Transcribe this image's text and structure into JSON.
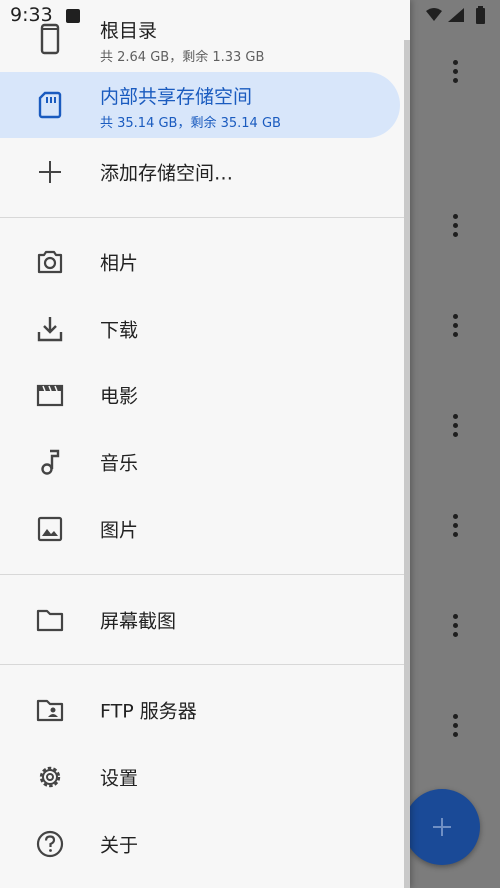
{
  "status_bar": {
    "time": "9:33"
  },
  "storage": [
    {
      "title": "根目录",
      "sub": "共 2.64 GB，剩余 1.33 GB",
      "icon": "phone-icon",
      "active": false
    },
    {
      "title": "内部共享存储空间",
      "sub": "共 35.14 GB，剩余 35.14 GB",
      "icon": "sd-card-icon",
      "active": true
    }
  ],
  "add_storage": {
    "label": "添加存储空间…",
    "icon": "plus-icon"
  },
  "libraries": [
    {
      "label": "相片",
      "icon": "camera-icon"
    },
    {
      "label": "下载",
      "icon": "download-icon"
    },
    {
      "label": "电影",
      "icon": "movie-icon"
    },
    {
      "label": "音乐",
      "icon": "music-icon"
    },
    {
      "label": "图片",
      "icon": "image-icon"
    }
  ],
  "bookmarks": [
    {
      "label": "屏幕截图",
      "icon": "folder-icon"
    }
  ],
  "other": [
    {
      "label": "FTP 服务器",
      "icon": "ftp-folder-icon"
    },
    {
      "label": "设置",
      "icon": "gear-icon"
    },
    {
      "label": "关于",
      "icon": "help-icon"
    }
  ],
  "colors": {
    "accent": "#1a5bbf",
    "active_bg": "#d8e6fa",
    "fab": "#1a4a97"
  }
}
